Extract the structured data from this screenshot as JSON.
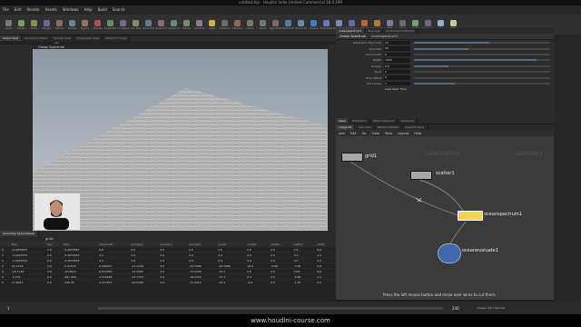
{
  "window": {
    "title": "untitled.hip - Houdini Indie Limited-Commercial 18.0.499"
  },
  "menu": [
    "File",
    "Edit",
    "Render",
    "Assets",
    "Windows",
    "Help",
    "Build",
    "Search"
  ],
  "shelf_tools": [
    {
      "label": "Create",
      "color": "#7a7a7a"
    },
    {
      "label": "Modify",
      "color": "#7f9a6a"
    },
    {
      "label": "Model",
      "color": "#8a8a5a"
    },
    {
      "label": "Polygon",
      "color": "#6a6a8a"
    },
    {
      "label": "Deform",
      "color": "#8a6a6a"
    },
    {
      "label": "Texture",
      "color": "#6a8a8a"
    },
    {
      "label": "Rigging",
      "color": "#8a7a6a"
    },
    {
      "label": "Muscles",
      "color": "#9a5a5a"
    },
    {
      "label": "Characters",
      "color": "#6a8a6a"
    },
    {
      "label": "Constraints",
      "color": "#7a6a8a"
    },
    {
      "label": "Hair Utils",
      "color": "#8a8a6a"
    },
    {
      "label": "Guide Process",
      "color": "#6a7a8a"
    },
    {
      "label": "Terrain FX",
      "color": "#8a6a7a"
    },
    {
      "label": "Simple FX",
      "color": "#6a8a7a"
    },
    {
      "label": "Volume",
      "color": "#7a8a6a"
    },
    {
      "label": "Cameras",
      "color": "#8a7a8a"
    },
    {
      "label": "Lights",
      "color": "#c9b04a"
    },
    {
      "label": "Collisions",
      "color": "#6a6a6a"
    },
    {
      "label": "Particles",
      "color": "#8a6a5a"
    },
    {
      "label": "Grains",
      "color": "#7a7a6a"
    },
    {
      "label": "Vellum",
      "color": "#6a7a7a"
    },
    {
      "label": "Rigid Bodies",
      "color": "#7a6a6a"
    },
    {
      "label": "Particle Fluids",
      "color": "#5a7a9a"
    },
    {
      "label": "Viscous Fluids",
      "color": "#6a8a9a"
    },
    {
      "label": "Oceans",
      "color": "#4a7ab0"
    },
    {
      "label": "Fluid Containers",
      "color": "#6a7ab0"
    },
    {
      "label": "Populate Containers",
      "color": "#7a8ab0"
    },
    {
      "label": "Container Tools",
      "color": "#6a6a9a"
    },
    {
      "label": "Pyro FX",
      "color": "#b06a3a"
    },
    {
      "label": "Sparse Pyro FX",
      "color": "#b07a4a"
    },
    {
      "label": "FEM",
      "color": "#7a7a9a"
    },
    {
      "label": "Wires",
      "color": "#6a6a6a"
    },
    {
      "label": "Crowds",
      "color": "#7a9a7a"
    },
    {
      "label": "Drive Simulation",
      "color": "#6a6a7a"
    },
    {
      "label": "Sky",
      "color": "#9ab0c9"
    },
    {
      "label": "Stars",
      "color": "#c9c99a"
    }
  ],
  "left_tabs": [
    "Scene View",
    "Animation Editor",
    "Render View",
    "Composite View",
    "Motion FX View"
  ],
  "path": "obj",
  "viewport_label": "Ocean Spectrum",
  "right_tabs": [
    "oceanspectrum1",
    "Take List",
    "Performance Monitor"
  ],
  "param_header": {
    "node_type": "Ocean Spectrum",
    "node_name": "oceanspectrum1"
  },
  "params": [
    {
      "label": "Resolution Exponent",
      "value": "10",
      "fill": 0.55
    },
    {
      "label": "Grid Size",
      "value": "50",
      "fill": 0.4
    },
    {
      "label": "Grid Center",
      "value": "0",
      "fill": 0
    },
    {
      "label": "Depth",
      "value": "1000",
      "fill": 0.9
    },
    {
      "label": "Gravity",
      "value": "9.8",
      "fill": 0.25
    },
    {
      "label": "Seed",
      "value": "0",
      "fill": 0
    },
    {
      "label": "Time Offset",
      "value": "0",
      "fill": 0
    },
    {
      "label": "Time Scale",
      "value": "1",
      "fill": 0.3
    },
    {
      "label": "",
      "value": "Loop Over Time",
      "fill": 0
    }
  ],
  "param_tabs": [
    "Wave",
    "Resolution",
    "Wave Instances",
    "Advanced"
  ],
  "net_tabs": [
    "/obj/grid1",
    "Tree View",
    "Material Palette",
    "Asset Browser"
  ],
  "net_menu": [
    "Add",
    "Edit",
    "Go",
    "View",
    "Tools",
    "Layout",
    "Help"
  ],
  "net_watermarks": [
    "Indie Edition",
    "Geometry"
  ],
  "nodes": [
    {
      "name": "grid1"
    },
    {
      "name": "scatter1"
    },
    {
      "name": "oceanspectrum1"
    },
    {
      "name": "oceanevaluate1"
    }
  ],
  "net_hint": "Press the left mouse button and move over wires to cut them.",
  "sheet": {
    "title": "Geometry Spreadsheet",
    "node": "grid1",
    "headers": [
      "",
      "P[x]",
      "P[y]",
      "P[z]",
      "amplitude",
      "phase[0]",
      "phase[1]",
      "phase[2]",
      "power",
      "rest[0]",
      "rest[1]",
      "rest[2]",
      "width"
    ],
    "rows": [
      [
        "0",
        "-2.4970553",
        "0.0",
        "-4.9970553",
        "0.0",
        "0.0",
        "0.0",
        "0.0",
        "0.0",
        "0.0",
        "0.0",
        "0.0",
        "0.0"
      ],
      [
        "1",
        "-3.4970553",
        "0.0",
        "-3.4970553",
        "0.0",
        "0.0",
        "0.0",
        "0.0",
        "0.0",
        "0.0",
        "0.0",
        "0.0",
        "0.0"
      ],
      [
        "2",
        "-3.4970553",
        "0.0",
        "-2.4970553",
        "0.0",
        "0.0",
        "0.0",
        "0.0",
        "0.0",
        "0.0",
        "0.0",
        "0.0",
        "0.0"
      ],
      [
        "3",
        "16.7219",
        "0.0",
        "-5.37979",
        "0.406077",
        "-13.1239",
        "0.0",
        "-24.7268",
        "-24.7268",
        "19.3",
        "-2.99",
        "-7.85",
        "0.0"
      ],
      [
        "4",
        "-15.1115",
        "0.0",
        "-19.9510",
        "0.812560",
        "-14.3255",
        "0.0",
        "-13.4339",
        "-15.3",
        "0.0",
        "0.0",
        "0.05",
        "0.0"
      ],
      [
        "5",
        "-3.230",
        "0.0",
        "-461.363",
        "0.434289",
        "-12.7335",
        "0.0",
        "-18.4793",
        "-15.3",
        "0.0",
        "0.0",
        "-9.84",
        "0.0"
      ],
      [
        "6",
        "17.9007",
        "0.0",
        "-330.35",
        "0.417957",
        "-33.5190",
        "0.0",
        "-15.2311",
        "-25.4",
        "-0.6",
        "0.0",
        "-1.87",
        "0.0"
      ]
    ]
  },
  "timeline": {
    "frame": "1",
    "start": "1",
    "end": "240",
    "range_end": "240",
    "keys_label": "0 keys, 0/0 channels",
    "key_all": "Key All Channels",
    "autoupdate": "Auto Update"
  },
  "caption": "www.houdini-course.com",
  "colors": {
    "accent": "#4a7ab0",
    "node_selected": "#f2d54d",
    "net_bg": "#3b3b3b"
  }
}
